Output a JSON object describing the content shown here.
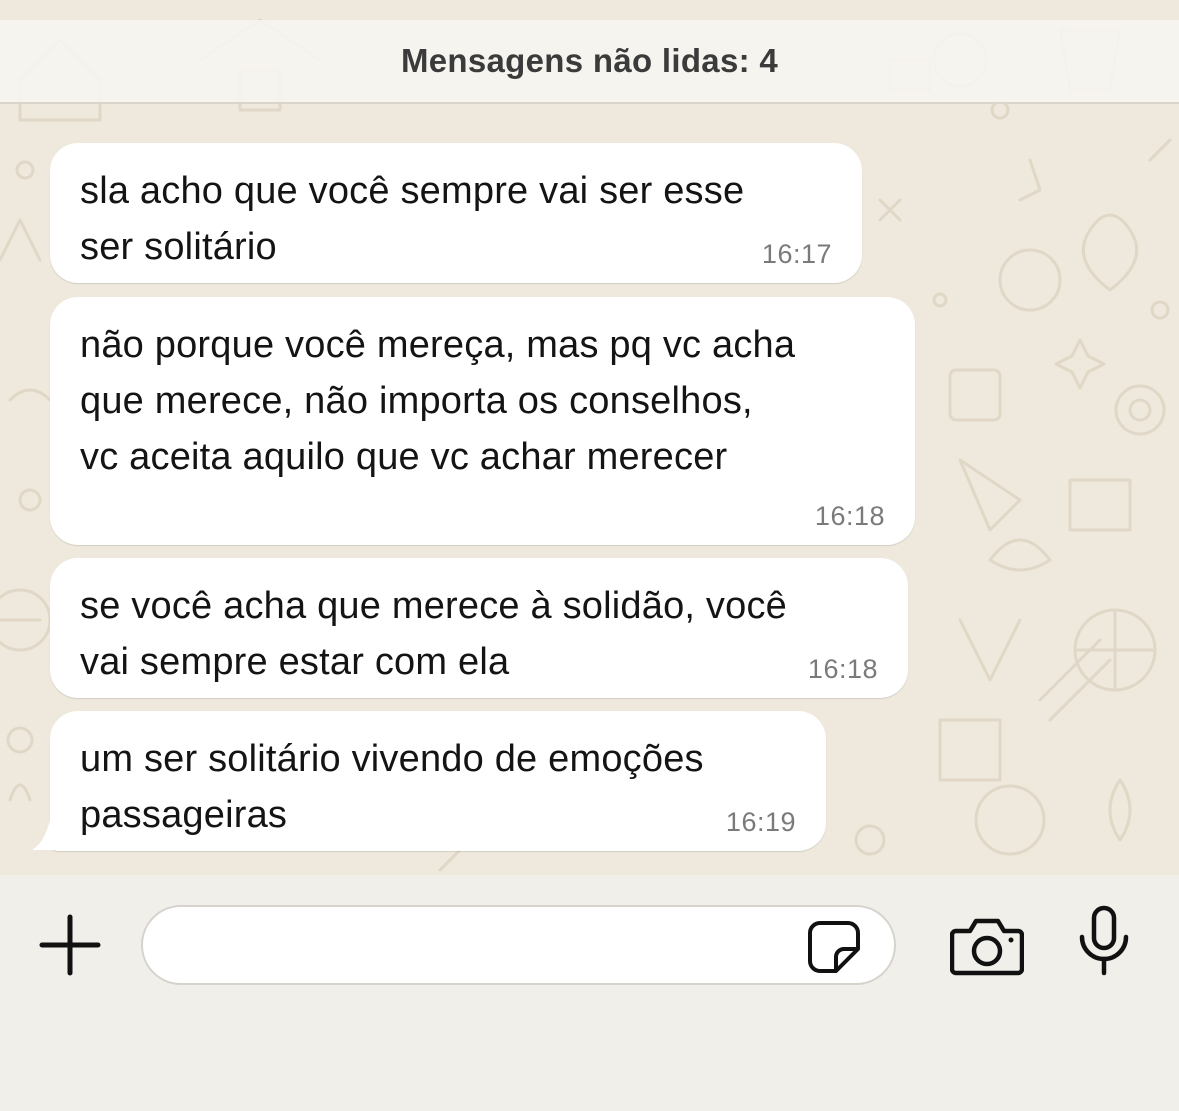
{
  "banner": {
    "unread_label": "Mensagens não lidas: 4"
  },
  "messages": [
    {
      "lines": [
        "sla acho que você sempre vai ser esse",
        "ser solitário"
      ],
      "time": "16:17"
    },
    {
      "lines": [
        "não porque você mereça, mas pq vc acha",
        "que merece, não importa os conselhos,",
        "vc aceita aquilo que vc achar merecer"
      ],
      "time": "16:18"
    },
    {
      "lines": [
        "se você acha que merece à solidão, você",
        "vai sempre estar com ela"
      ],
      "time": "16:18"
    },
    {
      "lines": [
        "um ser solitário vivendo de emoções",
        "passageiras"
      ],
      "time": "16:19"
    }
  ],
  "composer": {
    "attach_icon": "plus-icon",
    "sticker_icon": "sticker-icon",
    "camera_icon": "camera-icon",
    "mic_icon": "microphone-icon",
    "placeholder": ""
  },
  "colors": {
    "chat_background": "#efe9dd",
    "bubble": "#ffffff",
    "text": "#141414",
    "timestamp": "#7a7a7a",
    "composer_background": "#f1efea"
  }
}
